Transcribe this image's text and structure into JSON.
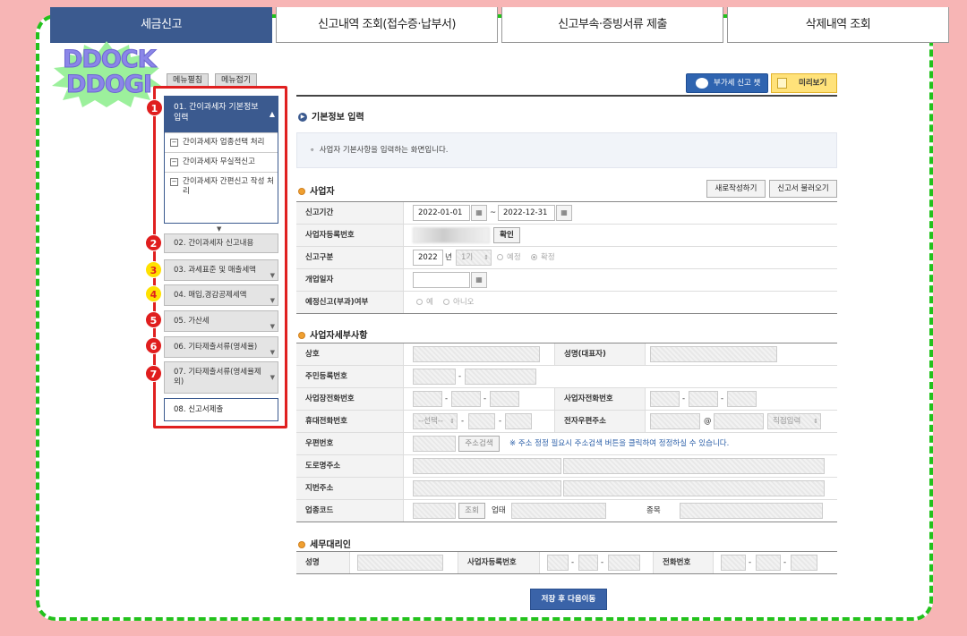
{
  "tabs": [
    {
      "label": "세금신고"
    },
    {
      "label": "신고내역 조회(접수증·납부서)"
    },
    {
      "label": "신고부속·증빙서류 제출"
    },
    {
      "label": "삭제내역 조회"
    }
  ],
  "logo": {
    "line1": "DDOCK",
    "line2": "DDOGI"
  },
  "menu": {
    "expand": "메뉴펼침",
    "collapse": "메뉴접기"
  },
  "sidebar": {
    "open_title": "01. 간이과세자 기본정보 입력",
    "sub": [
      "간이과세자 업종선택 처리",
      "간이과세자 무실적신고",
      "간이과세자 간편신고 작성 처리"
    ],
    "items": [
      "02. 간이과세자 신고내용",
      "03. 과세표준 및 매출세액",
      "04. 매입,경감공제세액",
      "05. 가산세",
      "06. 기타제출서류(영세율)",
      "07. 기타제출서류(영세율제외)",
      "08. 신고서제출"
    ],
    "badges": [
      "1",
      "2",
      "3",
      "4",
      "5",
      "6",
      "7"
    ]
  },
  "top": {
    "chatbot": "부가세 신고 챗봇",
    "preview": "미리보기"
  },
  "section": {
    "title": "기본정보 입력",
    "info": "사업자 기본사항을 입력하는 화면입니다."
  },
  "biz": {
    "title": "사업자",
    "new_btn": "새로작성하기",
    "load_btn": "신고서 불러오기",
    "period_label": "신고기간",
    "start": "2022-01-01",
    "tilde": "~",
    "end": "2022-12-31",
    "regno_label": "사업자등록번호",
    "confirm": "확인",
    "type_label": "신고구분",
    "year": "2022",
    "year_unit": "년",
    "term": "1기",
    "pre": "예정",
    "fixed": "확정",
    "open_label": "개업일자",
    "pre_label": "예정신고(부과)여부",
    "yes": "예",
    "no": "아니오"
  },
  "detail": {
    "title": "사업자세부사항",
    "trade": "상호",
    "ceo": "성명(대표자)",
    "rrn": "주민등록번호",
    "shop_tel": "사업장전화번호",
    "biz_tel": "사업자전화번호",
    "mobile": "휴대전화번호",
    "select": "--선택--",
    "email": "전자우편주소",
    "at": "@",
    "direct": "직접입력",
    "zip": "우편번호",
    "zip_btn": "주소검색",
    "zip_note": "※ 주소 정정 필요시 주소검색 버튼을 클릭하여 정정하실 수 있습니다.",
    "road": "도로명주소",
    "lot": "지번주소",
    "industry": "업종코드",
    "lookup": "조회",
    "biz_type": "업태",
    "item": "종목",
    "dash": "-"
  },
  "agent": {
    "title": "세무대리인",
    "name": "성명",
    "regno": "사업자등록번호",
    "tel": "전화번호"
  },
  "save": "저장 후 다음이동"
}
